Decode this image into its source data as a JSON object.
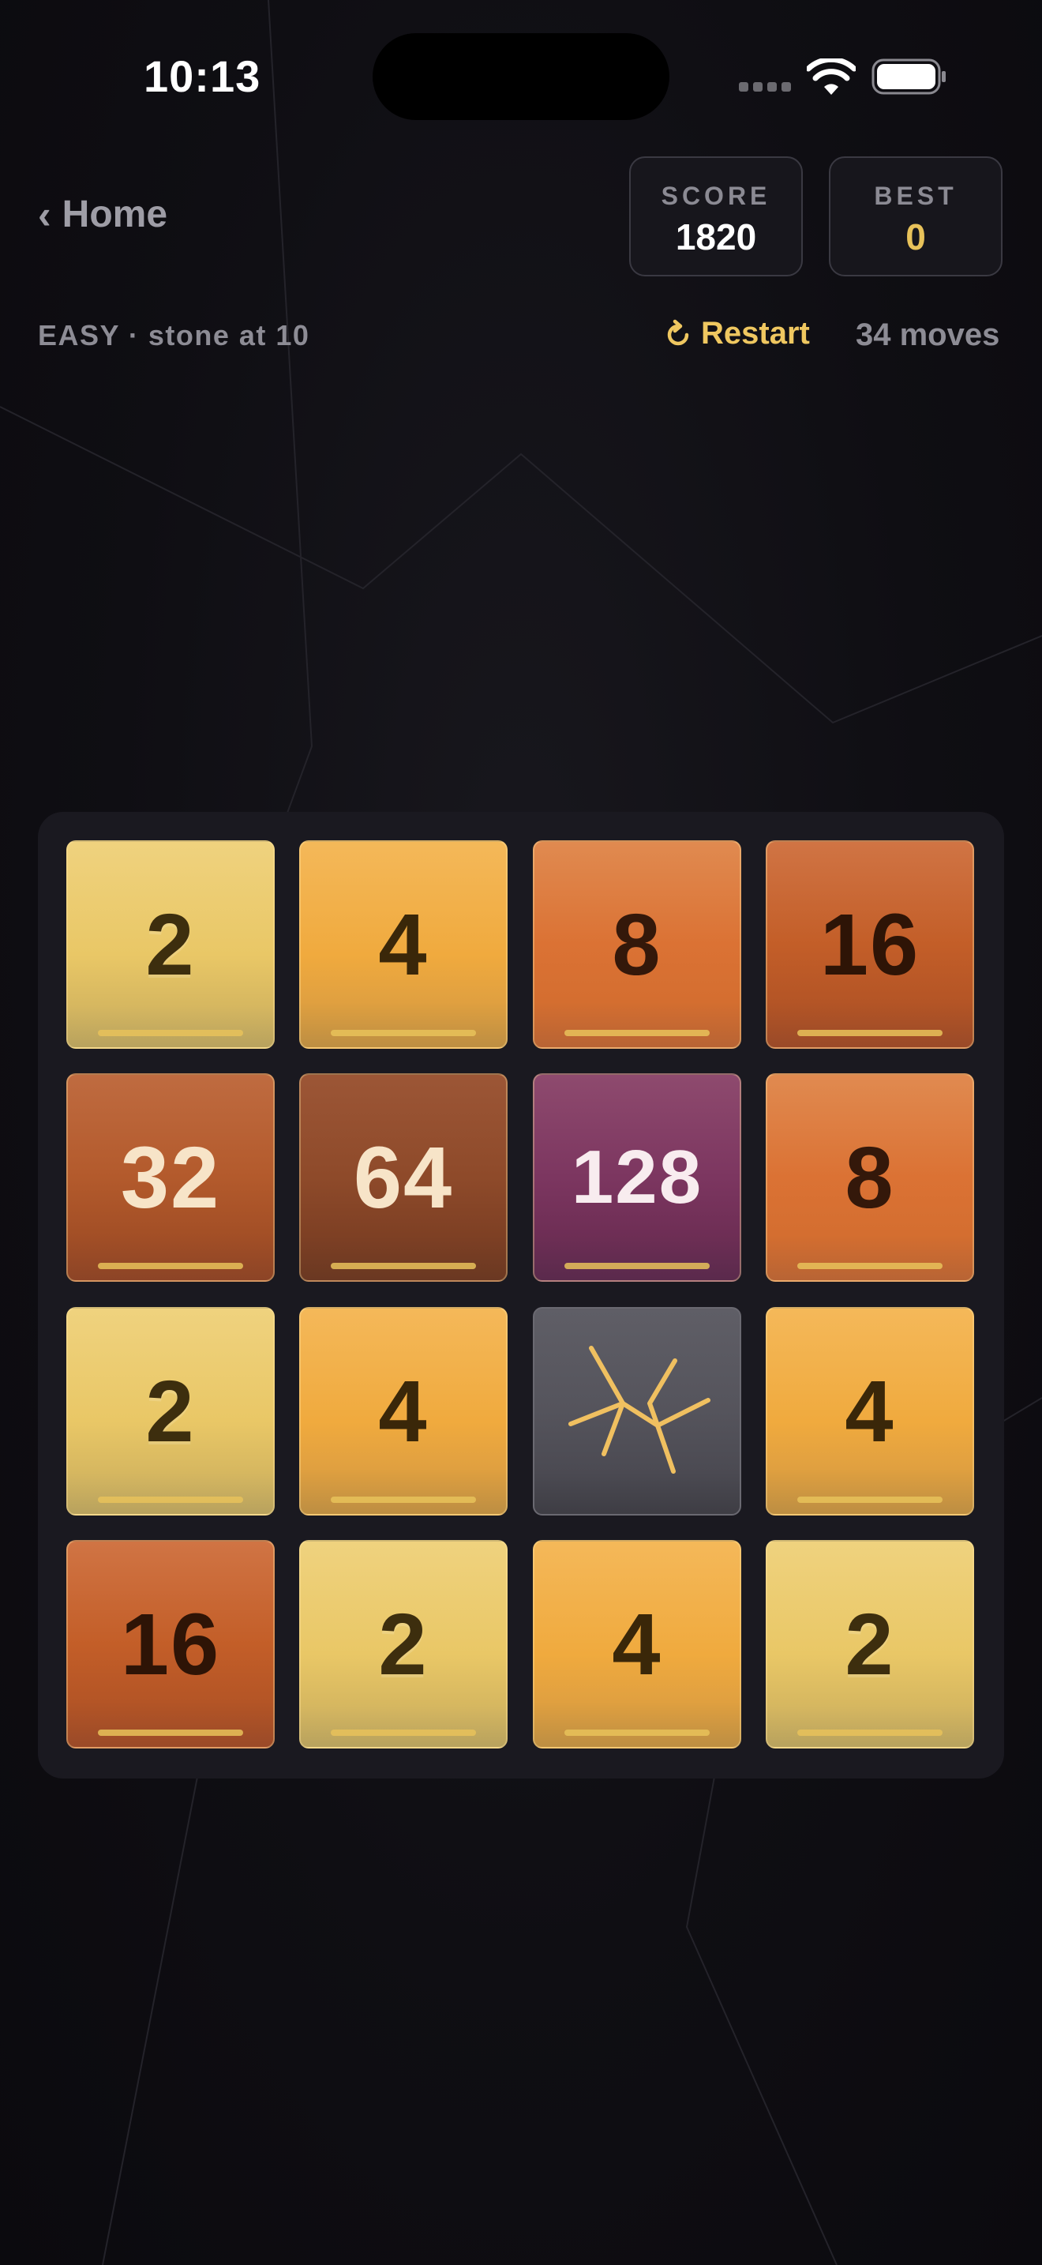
{
  "status_bar": {
    "time": "10:13"
  },
  "header": {
    "back_label": "Home",
    "score_label": "SCORE",
    "score_value": "1820",
    "best_label": "BEST",
    "best_value": "0"
  },
  "info": {
    "mode": "EASY · stone at 10",
    "restart_label": "Restart",
    "moves": "34 moves"
  },
  "board": {
    "rows": [
      [
        "2",
        "4",
        "8",
        "16"
      ],
      [
        "32",
        "64",
        "128",
        "8"
      ],
      [
        "2",
        "4",
        "stone",
        "4"
      ],
      [
        "16",
        "2",
        "4",
        "2"
      ]
    ]
  },
  "colors": {
    "accent": "#e8c25a",
    "background": "#0e0d12",
    "board": "#1a1920"
  }
}
